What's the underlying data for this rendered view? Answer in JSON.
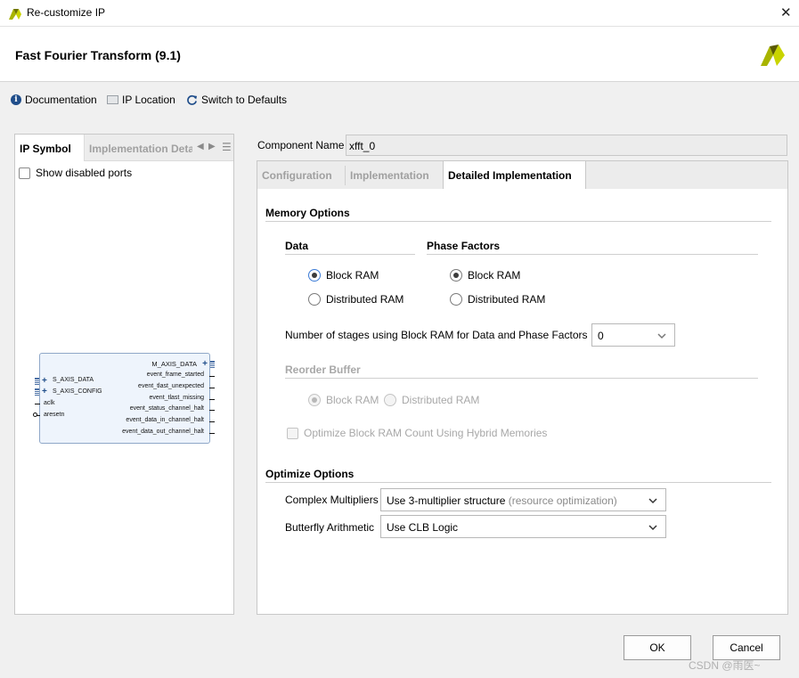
{
  "window": {
    "title": "Re-customize IP"
  },
  "header": {
    "title": "Fast Fourier Transform (9.1)"
  },
  "toolbar": {
    "documentation": "Documentation",
    "ip_location": "IP Location",
    "switch_defaults": "Switch to Defaults"
  },
  "left_panel": {
    "tab_ip_symbol": "IP Symbol",
    "tab_impl_details": "Implementation Deta",
    "show_disabled_ports": "Show disabled ports",
    "ip_symbol": {
      "left_ports": [
        "S_AXIS_DATA",
        "S_AXIS_CONFIG",
        "aclk",
        "aresetn"
      ],
      "right_ports": [
        "M_AXIS_DATA",
        "event_frame_started",
        "event_tlast_unexpected",
        "event_tlast_missing",
        "event_status_channel_halt",
        "event_data_in_channel_halt",
        "event_data_out_channel_halt"
      ]
    }
  },
  "component": {
    "label": "Component Name",
    "value": "xfft_0"
  },
  "tabs": {
    "configuration": "Configuration",
    "implementation": "Implementation",
    "detailed_implementation": "Detailed Implementation"
  },
  "memory_options": {
    "title": "Memory Options",
    "data": {
      "title": "Data",
      "block_ram": "Block RAM",
      "distributed_ram": "Distributed RAM",
      "selected": "block_ram"
    },
    "phase_factors": {
      "title": "Phase Factors",
      "block_ram": "Block RAM",
      "distributed_ram": "Distributed RAM",
      "selected": "block_ram"
    },
    "stages_label": "Number of stages using Block RAM for Data and Phase Factors",
    "stages_value": "0",
    "reorder_buffer": {
      "title": "Reorder Buffer",
      "block_ram": "Block RAM",
      "distributed_ram": "Distributed RAM",
      "selected": "block_ram",
      "enabled": false
    },
    "hybrid_memories": "Optimize Block RAM Count Using Hybrid Memories"
  },
  "optimize_options": {
    "title": "Optimize Options",
    "complex_multipliers_label": "Complex Multipliers",
    "complex_multipliers_value": "Use 3-multiplier structure",
    "complex_multipliers_hint": "(resource optimization)",
    "butterfly_label": "Butterfly Arithmetic",
    "butterfly_value": "Use CLB Logic"
  },
  "buttons": {
    "ok": "OK",
    "cancel": "Cancel"
  },
  "watermark": "CSDN @雨医~",
  "colors": {
    "accent": "#3b7bd6",
    "logo_yellow": "#a8b400",
    "logo_dark": "#5a5a00"
  }
}
